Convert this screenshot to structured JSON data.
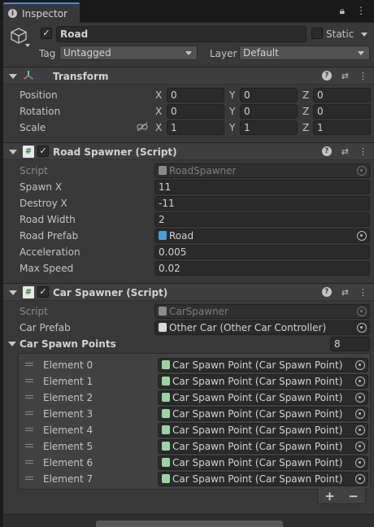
{
  "window": {
    "tab_title": "Inspector",
    "icons": [
      "info-icon",
      "lock-icon",
      "kebab-menu-icon"
    ]
  },
  "gameobject": {
    "active": true,
    "name": "Road",
    "static_label": "Static",
    "static": false,
    "tag_label": "Tag",
    "tag_value": "Untagged",
    "layer_label": "Layer",
    "layer_value": "Default"
  },
  "transform": {
    "title": "Transform",
    "rows": [
      {
        "label": "Position",
        "x": "0",
        "y": "0",
        "z": "0"
      },
      {
        "label": "Rotation",
        "x": "0",
        "y": "0",
        "z": "0"
      },
      {
        "label": "Scale",
        "x": "1",
        "y": "1",
        "z": "1"
      }
    ],
    "axis": {
      "x": "X",
      "y": "Y",
      "z": "Z"
    }
  },
  "road_spawner": {
    "title": "Road Spawner (Script)",
    "enabled": true,
    "script_label": "Script",
    "script_value": "RoadSpawner",
    "fields": [
      {
        "label": "Spawn X",
        "value": "11"
      },
      {
        "label": "Destroy X",
        "value": "-11"
      },
      {
        "label": "Road Width",
        "value": "2"
      },
      {
        "label": "Road Prefab",
        "value": "Road"
      },
      {
        "label": "Acceleration",
        "value": "0.005"
      },
      {
        "label": "Max Speed",
        "value": "0.02"
      }
    ]
  },
  "car_spawner": {
    "title": "Car Spawner (Script)",
    "enabled": true,
    "script_label": "Script",
    "script_value": "CarSpawner",
    "car_prefab_label": "Car Prefab",
    "car_prefab_value": "Other Car (Other Car Controller)",
    "spawn_points_label": "Car Spawn Points",
    "spawn_points_size": "8",
    "elements": [
      {
        "label": "Element 0",
        "value": "Car Spawn Point (Car Spawn Point)"
      },
      {
        "label": "Element 1",
        "value": "Car Spawn Point (Car Spawn Point)"
      },
      {
        "label": "Element 2",
        "value": "Car Spawn Point (Car Spawn Point)"
      },
      {
        "label": "Element 3",
        "value": "Car Spawn Point (Car Spawn Point)"
      },
      {
        "label": "Element 4",
        "value": "Car Spawn Point (Car Spawn Point)"
      },
      {
        "label": "Element 5",
        "value": "Car Spawn Point (Car Spawn Point)"
      },
      {
        "label": "Element 6",
        "value": "Car Spawn Point (Car Spawn Point)"
      },
      {
        "label": "Element 7",
        "value": "Car Spawn Point (Car Spawn Point)"
      }
    ],
    "add_label": "+",
    "remove_label": "−"
  },
  "colors": {
    "panel": "#383838",
    "header": "#3e3e3e",
    "field": "#2a2a2a",
    "accent": "#4a8ad9"
  }
}
